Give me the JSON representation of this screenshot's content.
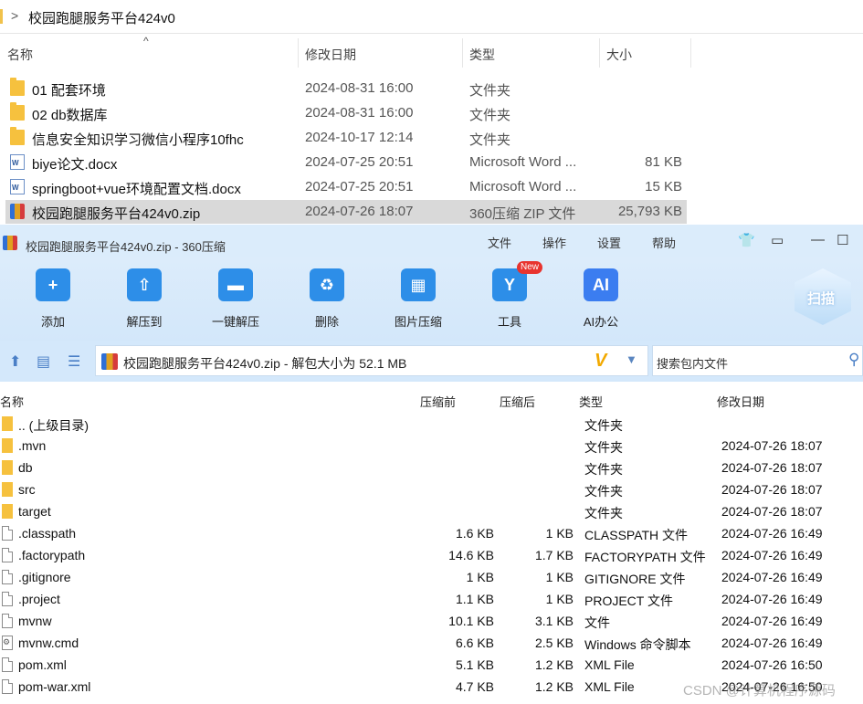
{
  "explorer": {
    "path": "校园跑腿服务平台424v0",
    "columns": {
      "name": "名称",
      "date": "修改日期",
      "type": "类型",
      "size": "大小"
    },
    "rows": [
      {
        "name": "01 配套环境",
        "date": "2024-08-31 16:00",
        "type": "文件夹",
        "size": "",
        "icon": "folder-icon"
      },
      {
        "name": "02 db数据库",
        "date": "2024-08-31 16:00",
        "type": "文件夹",
        "size": "",
        "icon": "folder-icon"
      },
      {
        "name": "信息安全知识学习微信小程序10fhc",
        "date": "2024-10-17 12:14",
        "type": "文件夹",
        "size": "",
        "icon": "folder-icon"
      },
      {
        "name": "biye论文.docx",
        "date": "2024-07-25 20:51",
        "type": "Microsoft Word ...",
        "size": "81 KB",
        "icon": "word-doc-icon"
      },
      {
        "name": "springboot+vue环境配置文档.docx",
        "date": "2024-07-25 20:51",
        "type": "Microsoft Word ...",
        "size": "15 KB",
        "icon": "word-doc-icon"
      },
      {
        "name": "校园跑腿服务平台424v0.zip",
        "date": "2024-07-26 18:07",
        "type": "360压缩 ZIP 文件",
        "size": "25,793 KB",
        "icon": "zip-archive-icon",
        "selected": true
      }
    ]
  },
  "zipwin": {
    "title": "校园跑腿服务平台424v0.zip - 360压缩",
    "menu": [
      "文件",
      "操作",
      "设置",
      "帮助"
    ],
    "tools": [
      {
        "label": "添加",
        "icon": "add-icon",
        "color": "#2d8ee8"
      },
      {
        "label": "解压到",
        "icon": "extract-to-icon",
        "color": "#2d8ee8"
      },
      {
        "label": "一键解压",
        "icon": "one-click-extract-icon",
        "color": "#2d8ee8"
      },
      {
        "label": "删除",
        "icon": "delete-icon",
        "color": "#2d8ee8"
      },
      {
        "label": "图片压缩",
        "icon": "image-compress-icon",
        "color": "#2d8ee8"
      },
      {
        "label": "工具",
        "icon": "tools-icon",
        "color": "#2d8ee8",
        "badge": "New"
      },
      {
        "label": "AI办公",
        "icon": "ai-office-icon",
        "color": "#3b7df0"
      }
    ],
    "scan_label": "扫描",
    "address": "校园跑腿服务平台424v0.zip - 解包大小为 52.1 MB",
    "search_placeholder": "搜索包内文件",
    "columns": {
      "name": "名称",
      "packed": "压缩前",
      "compressed": "压缩后",
      "type": "类型",
      "date": "修改日期"
    },
    "rows": [
      {
        "name": ".. (上级目录)",
        "before": "",
        "after": "",
        "type": "文件夹",
        "date": "",
        "kind": "folder"
      },
      {
        "name": ".mvn",
        "before": "",
        "after": "",
        "type": "文件夹",
        "date": "2024-07-26 18:07",
        "kind": "folder"
      },
      {
        "name": "db",
        "before": "",
        "after": "",
        "type": "文件夹",
        "date": "2024-07-26 18:07",
        "kind": "folder"
      },
      {
        "name": "src",
        "before": "",
        "after": "",
        "type": "文件夹",
        "date": "2024-07-26 18:07",
        "kind": "folder"
      },
      {
        "name": "target",
        "before": "",
        "after": "",
        "type": "文件夹",
        "date": "2024-07-26 18:07",
        "kind": "folder"
      },
      {
        "name": ".classpath",
        "before": "1.6 KB",
        "after": "1 KB",
        "type": "CLASSPATH 文件",
        "date": "2024-07-26 16:49",
        "kind": "file"
      },
      {
        "name": ".factorypath",
        "before": "14.6 KB",
        "after": "1.7 KB",
        "type": "FACTORYPATH 文件",
        "date": "2024-07-26 16:49",
        "kind": "file"
      },
      {
        "name": ".gitignore",
        "before": "1 KB",
        "after": "1 KB",
        "type": "GITIGNORE 文件",
        "date": "2024-07-26 16:49",
        "kind": "file"
      },
      {
        "name": ".project",
        "before": "1.1 KB",
        "after": "1 KB",
        "type": "PROJECT 文件",
        "date": "2024-07-26 16:49",
        "kind": "file"
      },
      {
        "name": "mvnw",
        "before": "10.1 KB",
        "after": "3.1 KB",
        "type": "文件",
        "date": "2024-07-26 16:49",
        "kind": "file"
      },
      {
        "name": "mvnw.cmd",
        "before": "6.6 KB",
        "after": "2.5 KB",
        "type": "Windows 命令脚本",
        "date": "2024-07-26 16:49",
        "kind": "cmd"
      },
      {
        "name": "pom.xml",
        "before": "5.1 KB",
        "after": "1.2 KB",
        "type": "XML File",
        "date": "2024-07-26 16:50",
        "kind": "file"
      },
      {
        "name": "pom-war.xml",
        "before": "4.7 KB",
        "after": "1.2 KB",
        "type": "XML File",
        "date": "2024-07-26 16:50",
        "kind": "file"
      }
    ]
  },
  "watermark": "CSDN @计算机程序源码"
}
